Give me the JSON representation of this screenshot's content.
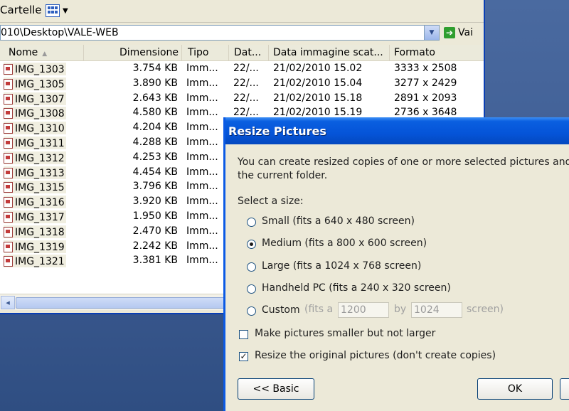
{
  "explorer": {
    "toolbar_label": "Cartelle",
    "address": "010\\Desktop\\VALE-WEB",
    "go_label": "Vai",
    "columns": [
      "Nome",
      "Dimensione",
      "Tipo",
      "Dat...",
      "Data immagine scat...",
      "Formato"
    ],
    "files": [
      {
        "name": "IMG_1303",
        "size": "3.754 KB",
        "type": "Imm...",
        "date": "22/...",
        "taken": "21/02/2010 15.02",
        "format": "3333 x 2508"
      },
      {
        "name": "IMG_1305",
        "size": "3.890 KB",
        "type": "Imm...",
        "date": "22/...",
        "taken": "21/02/2010 15.04",
        "format": "3277 x 2429"
      },
      {
        "name": "IMG_1307",
        "size": "2.643 KB",
        "type": "Imm...",
        "date": "22/...",
        "taken": "21/02/2010 15.18",
        "format": "2891 x 2093"
      },
      {
        "name": "IMG_1308",
        "size": "4.580 KB",
        "type": "Imm...",
        "date": "22/...",
        "taken": "21/02/2010 15.19",
        "format": "2736 x 3648"
      },
      {
        "name": "IMG_1310",
        "size": "4.204 KB",
        "type": "Imm...",
        "date": "",
        "taken": "",
        "format": ""
      },
      {
        "name": "IMG_1311",
        "size": "4.288 KB",
        "type": "Imm...",
        "date": "",
        "taken": "",
        "format": ""
      },
      {
        "name": "IMG_1312",
        "size": "4.253 KB",
        "type": "Imm...",
        "date": "",
        "taken": "",
        "format": ""
      },
      {
        "name": "IMG_1313",
        "size": "4.454 KB",
        "type": "Imm...",
        "date": "",
        "taken": "",
        "format": ""
      },
      {
        "name": "IMG_1315",
        "size": "3.796 KB",
        "type": "Imm...",
        "date": "",
        "taken": "",
        "format": ""
      },
      {
        "name": "IMG_1316",
        "size": "3.920 KB",
        "type": "Imm...",
        "date": "",
        "taken": "",
        "format": ""
      },
      {
        "name": "IMG_1317",
        "size": "1.950 KB",
        "type": "Imm...",
        "date": "",
        "taken": "",
        "format": ""
      },
      {
        "name": "IMG_1318",
        "size": "2.470 KB",
        "type": "Imm...",
        "date": "",
        "taken": "",
        "format": ""
      },
      {
        "name": "IMG_1319",
        "size": "2.242 KB",
        "type": "Imm...",
        "date": "",
        "taken": "",
        "format": ""
      },
      {
        "name": "IMG_1321",
        "size": "3.381 KB",
        "type": "Imm...",
        "date": "",
        "taken": "",
        "format": ""
      }
    ]
  },
  "dialog": {
    "title": "Resize Pictures",
    "intro_line1": "You can create resized copies of one or more selected pictures and sto",
    "intro_line2": "the current folder.",
    "select_label": "Select a size:",
    "options": [
      {
        "label": "Small (fits a 640 x 480 screen)",
        "selected": false
      },
      {
        "label": "Medium (fits a 800 x 600 screen)",
        "selected": true
      },
      {
        "label": "Large (fits a 1024 x 768 screen)",
        "selected": false
      },
      {
        "label": "Handheld PC (fits a 240 x 320 screen)",
        "selected": false
      }
    ],
    "custom": {
      "label": "Custom",
      "fits_a": "(fits a",
      "width": "1200",
      "by": "by",
      "height": "1024",
      "screen": "screen)"
    },
    "check_smaller": {
      "label": "Make pictures smaller but not larger",
      "checked": false
    },
    "check_original": {
      "label": "Resize the original pictures (don't create copies)",
      "checked": true
    },
    "basic_button": "<< Basic",
    "ok_button": "OK"
  }
}
